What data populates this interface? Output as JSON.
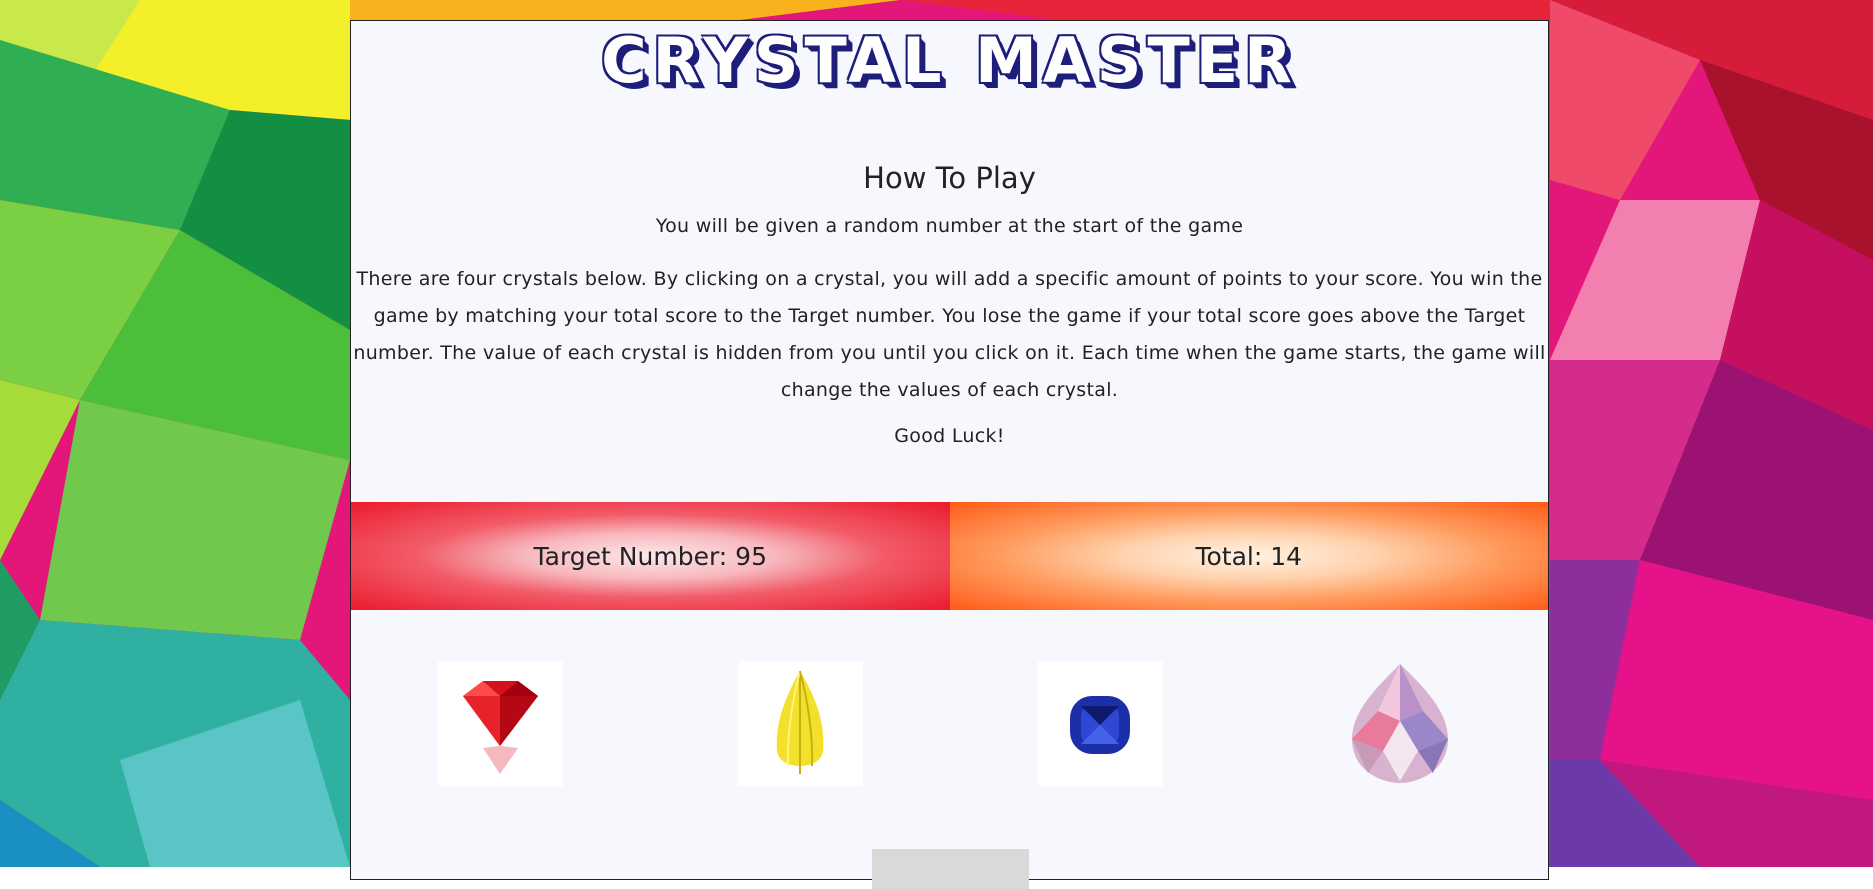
{
  "game": {
    "title": "CRYSTAL MASTER"
  },
  "instructions": {
    "heading": "How To Play",
    "line1": "You will be given a random number at the start of the game",
    "line2": "There are four crystals below. By clicking on a crystal, you will add a specific amount of points to your score. You win the game by matching your total score to the Target number. You lose the game if your total score goes above the Target number. The value of each crystal is hidden from you until you click on it. Each time when the game starts, the game will change the values of each crystal.",
    "line3": "Good Luck!"
  },
  "score": {
    "target_label": "Target Number: 95",
    "total_label": "Total: 14"
  },
  "crystals": [
    {
      "name": "red-crystal-icon",
      "color": "#d4101c"
    },
    {
      "name": "yellow-crystal-icon",
      "color": "#f2e02a"
    },
    {
      "name": "blue-crystal-icon",
      "color": "#1c2fa8"
    },
    {
      "name": "pink-crystal-icon",
      "color": "#e6a7c8"
    }
  ],
  "colors": {
    "title_outline": "#1d1e7a",
    "target_red": "#ea1a2c",
    "total_orange": "#ff5a17"
  }
}
